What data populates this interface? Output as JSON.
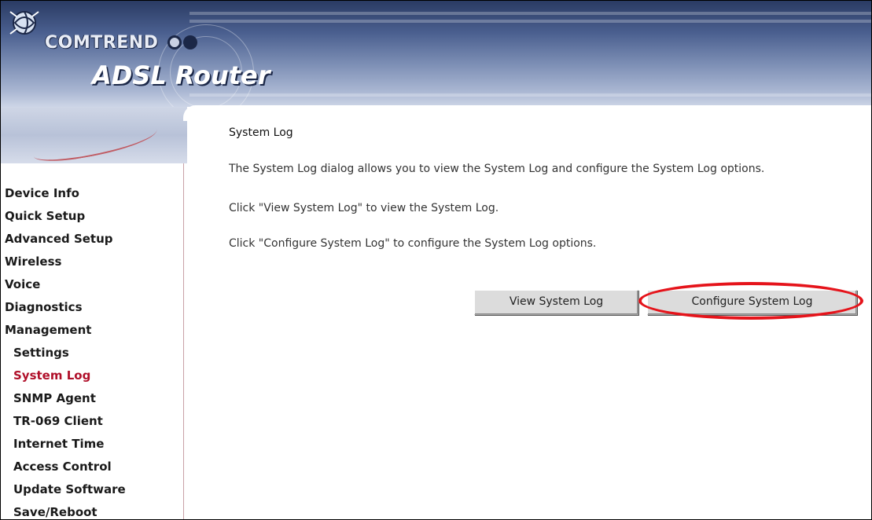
{
  "header": {
    "brand": "COMTREND",
    "product": "ADSL Router"
  },
  "sidebar": {
    "items": [
      {
        "label": "Device Info",
        "level": 0,
        "active": false
      },
      {
        "label": "Quick Setup",
        "level": 0,
        "active": false
      },
      {
        "label": "Advanced Setup",
        "level": 0,
        "active": false
      },
      {
        "label": "Wireless",
        "level": 0,
        "active": false
      },
      {
        "label": "Voice",
        "level": 0,
        "active": false
      },
      {
        "label": "Diagnostics",
        "level": 0,
        "active": false
      },
      {
        "label": "Management",
        "level": 0,
        "active": false
      },
      {
        "label": "Settings",
        "level": 1,
        "active": false
      },
      {
        "label": "System Log",
        "level": 1,
        "active": true
      },
      {
        "label": "SNMP Agent",
        "level": 1,
        "active": false
      },
      {
        "label": "TR-069 Client",
        "level": 1,
        "active": false
      },
      {
        "label": "Internet Time",
        "level": 1,
        "active": false
      },
      {
        "label": "Access Control",
        "level": 1,
        "active": false
      },
      {
        "label": "Update Software",
        "level": 1,
        "active": false
      },
      {
        "label": "Save/Reboot",
        "level": 1,
        "active": false
      }
    ]
  },
  "main": {
    "title": "System Log",
    "paragraphs": [
      "The System Log dialog allows you to view the System Log and configure the System Log options.",
      "Click \"View System Log\" to view the System Log.",
      "Click \"Configure System Log\" to configure the System Log options."
    ],
    "buttons": {
      "view": "View System Log",
      "configure": "Configure System Log"
    }
  },
  "colors": {
    "active_nav": "#b0102a",
    "highlight": "#e5141b"
  },
  "icons": {
    "logo": "comtrend-logo-icon"
  }
}
